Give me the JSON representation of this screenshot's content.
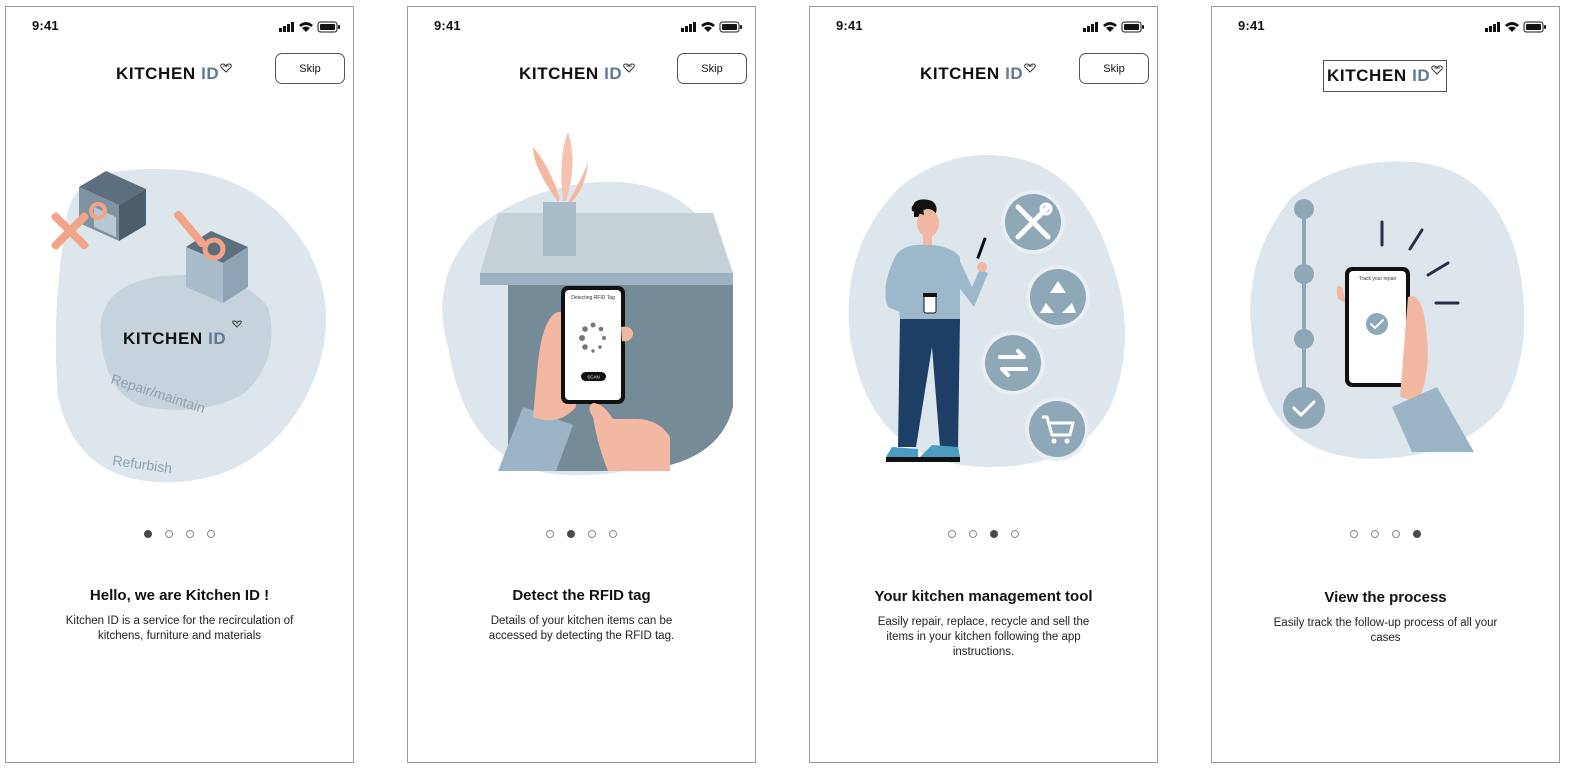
{
  "colors": {
    "blob": "#dde6ec",
    "blob_dark": "#c6d3dc",
    "accent_blue": "#8fa8b8",
    "navy": "#1d3f66",
    "skin": "#f2b8a2",
    "dark_dot": "#4a4a4a"
  },
  "screens": [
    {
      "time": "9:41",
      "logo": {
        "main": "KITCHEN ",
        "id": "ID"
      },
      "skip_label": "Skip",
      "illustration": {
        "logo_main": "KITCHEN ",
        "logo_id": "ID",
        "label_repair": "Repair/maintain",
        "label_refurbish": "Refurbish"
      },
      "title": "Hello, we are Kitchen ID !",
      "description": "Kitchen ID is a service for the recirculation of kitchens, furniture and materials",
      "active_page": 1
    },
    {
      "time": "9:41",
      "logo": {
        "main": "KITCHEN ",
        "id": "ID"
      },
      "skip_label": "Skip",
      "illustration": {
        "phone_heading": "Detecting RFID Tag",
        "phone_button": "SCAN"
      },
      "title": "Detect the RFID tag",
      "description": "Details of your kitchen items can be accessed by detecting the RFID tag.",
      "active_page": 2
    },
    {
      "time": "9:41",
      "logo": {
        "main": "KITCHEN ",
        "id": "ID"
      },
      "skip_label": "Skip",
      "illustration": {
        "icons": [
          "tools-icon",
          "recycle-icon",
          "swap-icon",
          "cart-icon"
        ]
      },
      "title": "Your kitchen management tool",
      "description": "Easily repair, replace, recycle and sell the items in your kitchen following the app instructions.",
      "active_page": 3
    },
    {
      "time": "9:41",
      "logo": {
        "main": "KITCHEN ",
        "id": "ID"
      },
      "illustration": {
        "phone_heading": "Track your repair"
      },
      "title": "View the process",
      "description": "Easily track the follow-up process of all your cases",
      "active_page": 4
    }
  ],
  "page_count": 4
}
